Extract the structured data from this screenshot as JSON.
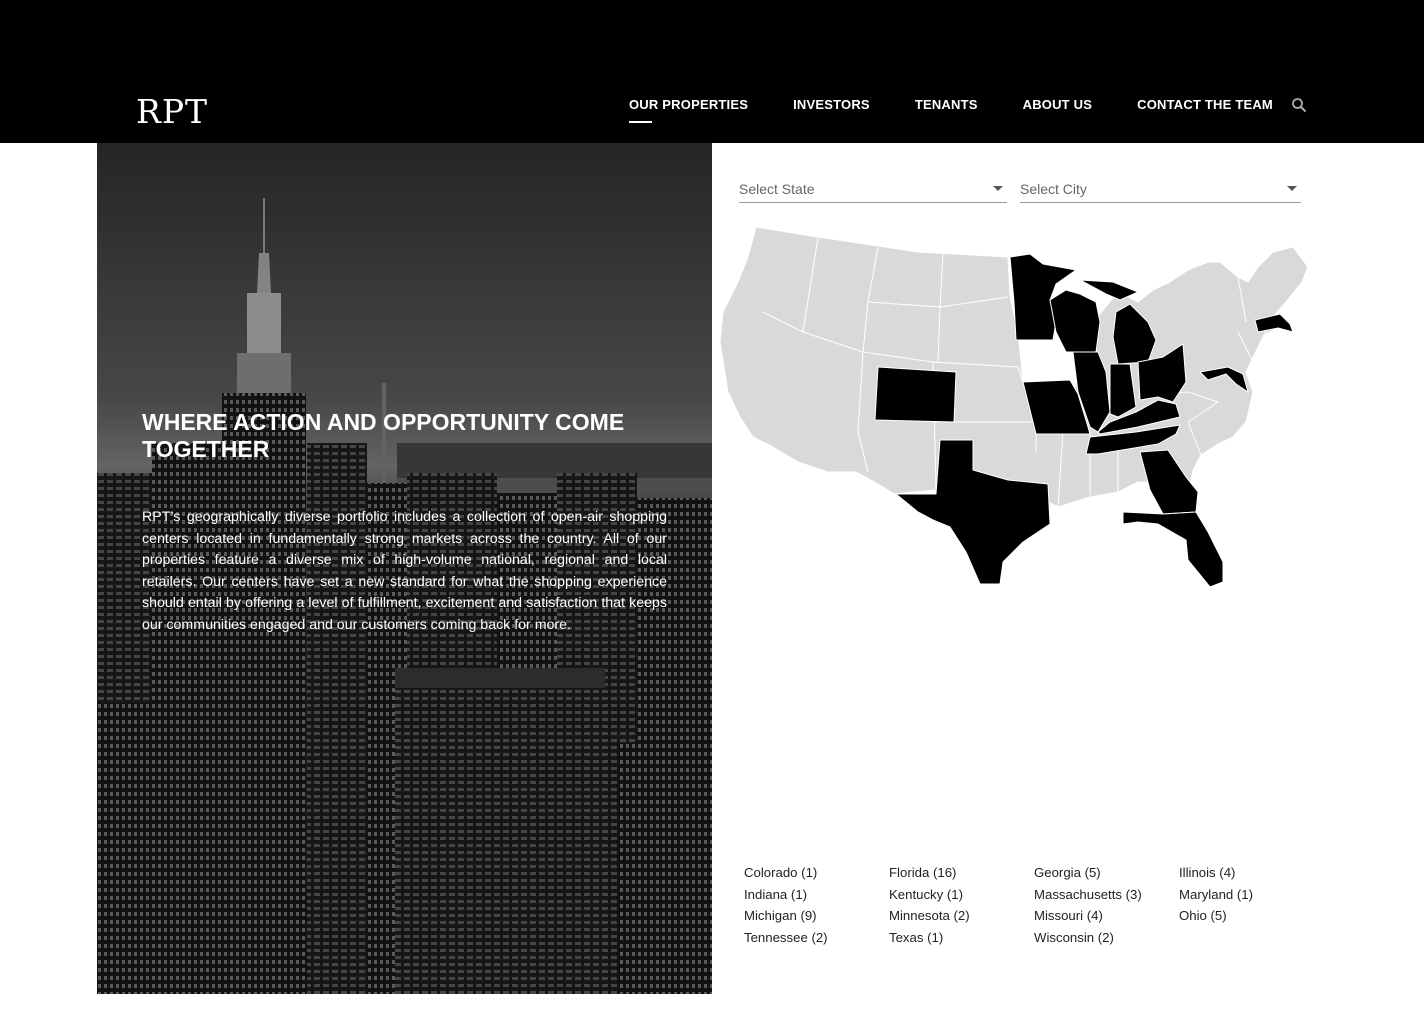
{
  "brand": {
    "logo_text": "RPT"
  },
  "nav": {
    "items": [
      {
        "label": "OUR PROPERTIES",
        "active": true
      },
      {
        "label": "INVESTORS"
      },
      {
        "label": "TENANTS"
      },
      {
        "label": "ABOUT US"
      },
      {
        "label": "CONTACT THE TEAM"
      }
    ],
    "search_icon": "search-icon"
  },
  "hero": {
    "title": "WHERE ACTION AND OPPORTUNITY COME TOGETHER",
    "body": "RPT’s geographically diverse portfolio includes a collection of open-air shopping centers located in fundamentally strong markets across the country. All of our properties feature a diverse mix of high-volume national, regional and local retailers. Our centers have set a new standard for what the shopping experience should entail by offering a level of fulfillment, excitement and satisfaction that keeps our communities engaged and our customers coming back for more."
  },
  "filters": {
    "state": {
      "placeholder": "Select State"
    },
    "city": {
      "placeholder": "Select City"
    }
  },
  "map": {
    "highlight_color": "#000000",
    "base_color": "#d9d9d9",
    "highlighted_states": [
      "Colorado",
      "Florida",
      "Georgia",
      "Illinois",
      "Indiana",
      "Kentucky",
      "Massachusetts",
      "Maryland",
      "Michigan",
      "Minnesota",
      "Missouri",
      "Ohio",
      "Tennessee",
      "Texas",
      "Wisconsin"
    ]
  },
  "state_list": [
    "Colorado (1)",
    "Florida (16)",
    "Georgia (5)",
    "Illinois (4)",
    "Indiana (1)",
    "Kentucky (1)",
    "Massachusetts (3)",
    "Maryland (1)",
    "Michigan (9)",
    "Minnesota (2)",
    "Missouri (4)",
    "Ohio (5)",
    "Tennessee (2)",
    "Texas (1)",
    "Wisconsin (2)"
  ]
}
